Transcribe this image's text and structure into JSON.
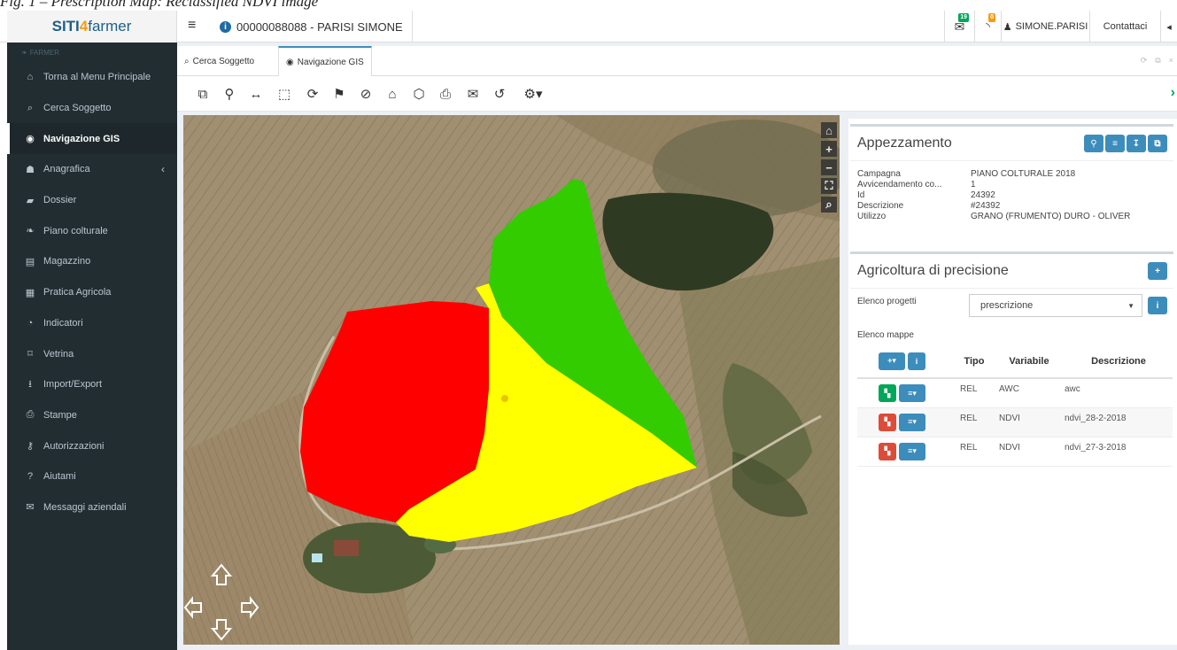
{
  "caption": "Fig. 1 – Prescription Map: Reclassified NDVI image",
  "brand": {
    "part1": "SITI",
    "part2": "4",
    "part3": "farmer"
  },
  "header": {
    "subject": "00000088088 - PARISI SIMONE",
    "mail_count": "19",
    "feed_count": "0",
    "user": "SIMONE.PARISI",
    "contact": "Contattaci"
  },
  "sidebar": {
    "section": "FARMER",
    "items": [
      {
        "label": "Torna al Menu Principale",
        "icon": "home-icon",
        "glyph": "⌂"
      },
      {
        "label": "Cerca Soggetto",
        "icon": "search-icon",
        "glyph": "⌕"
      },
      {
        "label": "Navigazione GIS",
        "icon": "globe-icon",
        "glyph": "◉"
      },
      {
        "label": "Anagrafica",
        "icon": "users-icon",
        "glyph": "☗"
      },
      {
        "label": "Dossier",
        "icon": "folder-icon",
        "glyph": "▰"
      },
      {
        "label": "Piano colturale",
        "icon": "leaf-icon",
        "glyph": "❧"
      },
      {
        "label": "Magazzino",
        "icon": "archive-icon",
        "glyph": "▤"
      },
      {
        "label": "Pratica Agricola",
        "icon": "calendar-icon",
        "glyph": "▦"
      },
      {
        "label": "Indicatori",
        "icon": "pie-chart-icon",
        "glyph": "◔"
      },
      {
        "label": "Vetrina",
        "icon": "bookmark-icon",
        "glyph": "⌑"
      },
      {
        "label": "Import/Export",
        "icon": "download-icon",
        "glyph": "⭳"
      },
      {
        "label": "Stampe",
        "icon": "print-icon",
        "glyph": "⎙"
      },
      {
        "label": "Autorizzazioni",
        "icon": "key-icon",
        "glyph": "⚷"
      },
      {
        "label": "Aiutami",
        "icon": "question-icon",
        "glyph": "?"
      },
      {
        "label": "Messaggi aziendali",
        "icon": "envelope-icon",
        "glyph": "✉"
      }
    ],
    "active_index": 2,
    "expandable_index": 3
  },
  "tabs": [
    {
      "label": "Cerca Soggetto",
      "icon": "search-icon",
      "glyph": "⌕"
    },
    {
      "label": "Navigazione GIS",
      "icon": "globe-icon",
      "glyph": "◉"
    }
  ],
  "toolbar": [
    {
      "icon": "copy-icon",
      "glyph": "⧉"
    },
    {
      "icon": "marker-icon",
      "glyph": "⚲"
    },
    {
      "icon": "measure-line-icon",
      "glyph": "↔"
    },
    {
      "icon": "measure-area-icon",
      "glyph": "⬚"
    },
    {
      "icon": "refresh-icon",
      "glyph": "⟳"
    },
    {
      "icon": "signpost-icon",
      "glyph": "⚑"
    },
    {
      "icon": "compass-icon",
      "glyph": "⊘"
    },
    {
      "icon": "home-icon",
      "glyph": "⌂"
    },
    {
      "icon": "cube-icon",
      "glyph": "⬡"
    },
    {
      "icon": "print-icon",
      "glyph": "⎙"
    },
    {
      "icon": "mail-badge-icon",
      "glyph": "✉"
    },
    {
      "icon": "undo-icon",
      "glyph": "↺"
    },
    {
      "icon": "puzzle-dropdown-icon",
      "glyph": "⚙▾"
    }
  ],
  "map_controls": [
    "⌂",
    "+",
    "−",
    "⛶",
    "⌕"
  ],
  "appezzamento": {
    "title": "Appezzamento",
    "fields": [
      {
        "label": "Campagna",
        "value": "PIANO COLTURALE 2018"
      },
      {
        "label": "Avvicendamento co...",
        "value": "1"
      },
      {
        "label": "Id",
        "value": "24392"
      },
      {
        "label": "Descrizione",
        "value": "#24392"
      },
      {
        "label": "Utilizzo",
        "value": "GRANO (FRUMENTO) DURO - OLIVER"
      }
    ]
  },
  "precision": {
    "title": "Agricoltura di precisione",
    "projects_label": "Elenco progetti",
    "projects_selected": "prescrizione",
    "maps_label": "Elenco mappe",
    "columns": [
      "Tipo",
      "Variabile",
      "Descrizione"
    ],
    "rows": [
      {
        "tipo": "REL",
        "variabile": "AWC",
        "descrizione": "awc",
        "status": "green"
      },
      {
        "tipo": "REL",
        "variabile": "NDVI",
        "descrizione": "ndvi_28-2-2018",
        "status": "red"
      },
      {
        "tipo": "REL",
        "variabile": "NDVI",
        "descrizione": "ndvi_27-3-2018",
        "status": "red"
      }
    ]
  },
  "colors": {
    "accent": "#3c8dbc",
    "sidebar": "#222d32",
    "zone_red": "#ff0000",
    "zone_yellow": "#ffff00",
    "zone_green": "#33cc00"
  }
}
